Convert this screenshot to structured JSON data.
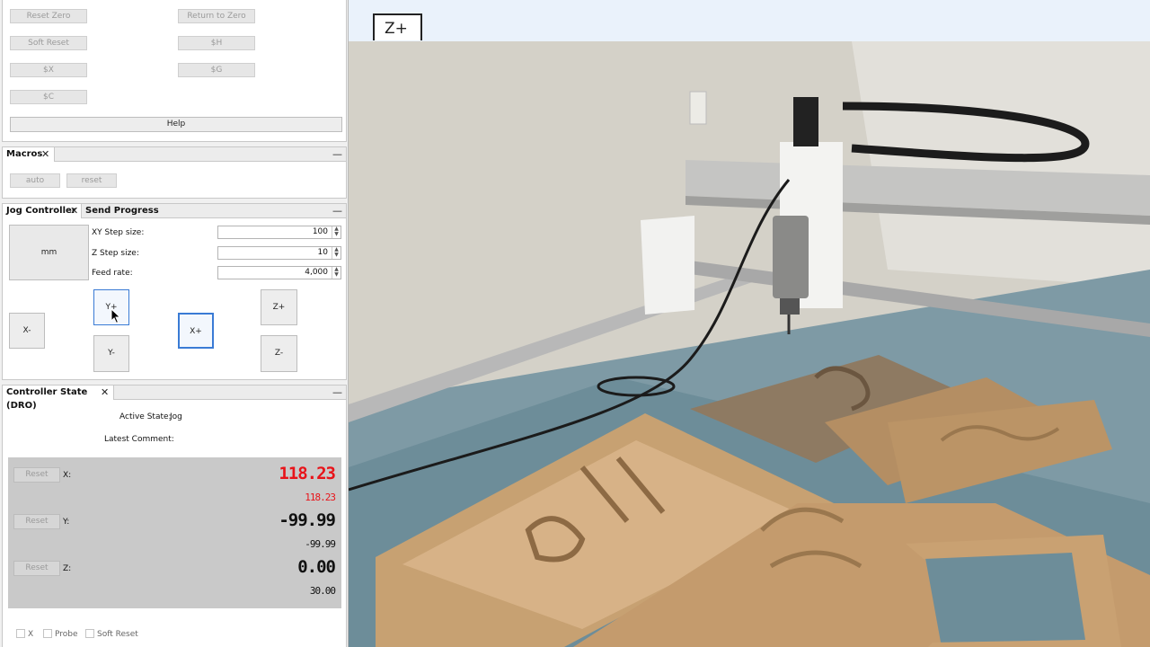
{
  "commands": {
    "reset_zero": "Reset Zero",
    "return_to_zero": "Return to Zero",
    "soft_reset": "Soft Reset",
    "dollar_h": "$H",
    "dollar_x": "$X",
    "dollar_g": "$G",
    "dollar_c": "$C",
    "help": "Help"
  },
  "macros": {
    "tab": "Macros",
    "buttons": [
      "auto",
      "reset"
    ]
  },
  "jog": {
    "tabs": [
      "Jog Controller",
      "Send Progress"
    ],
    "units_button": "mm",
    "xy_step_label": "XY Step size:",
    "xy_step_value": "100",
    "z_step_label": "Z Step size:",
    "z_step_value": "10",
    "feed_label": "Feed rate:",
    "feed_value": "4,000",
    "x_minus": "X-",
    "y_plus": "Y+",
    "y_minus": "Y-",
    "x_plus": "X+",
    "z_plus": "Z+",
    "z_minus": "Z-"
  },
  "dro": {
    "tab": "Controller State (DRO)",
    "active_state_label": "Active State:",
    "active_state_value": "Jog",
    "latest_comment_label": "Latest Comment:",
    "reset_label": "Reset",
    "x_label": "X:",
    "x_work": "118.23",
    "x_machine": "118.23",
    "y_label": "Y:",
    "y_work": "-99.99",
    "y_machine": "-99.99",
    "z_label": "Z:",
    "z_work": "0.00",
    "z_machine": "30.00"
  },
  "footer": {
    "x_check": "X",
    "probe_check": "Probe",
    "soft_reset_check": "Soft Reset"
  },
  "video": {
    "overlay_label": "Z+"
  },
  "colors": {
    "dro_highlight": "#e8141a",
    "focus_border": "#3a7bd5"
  }
}
